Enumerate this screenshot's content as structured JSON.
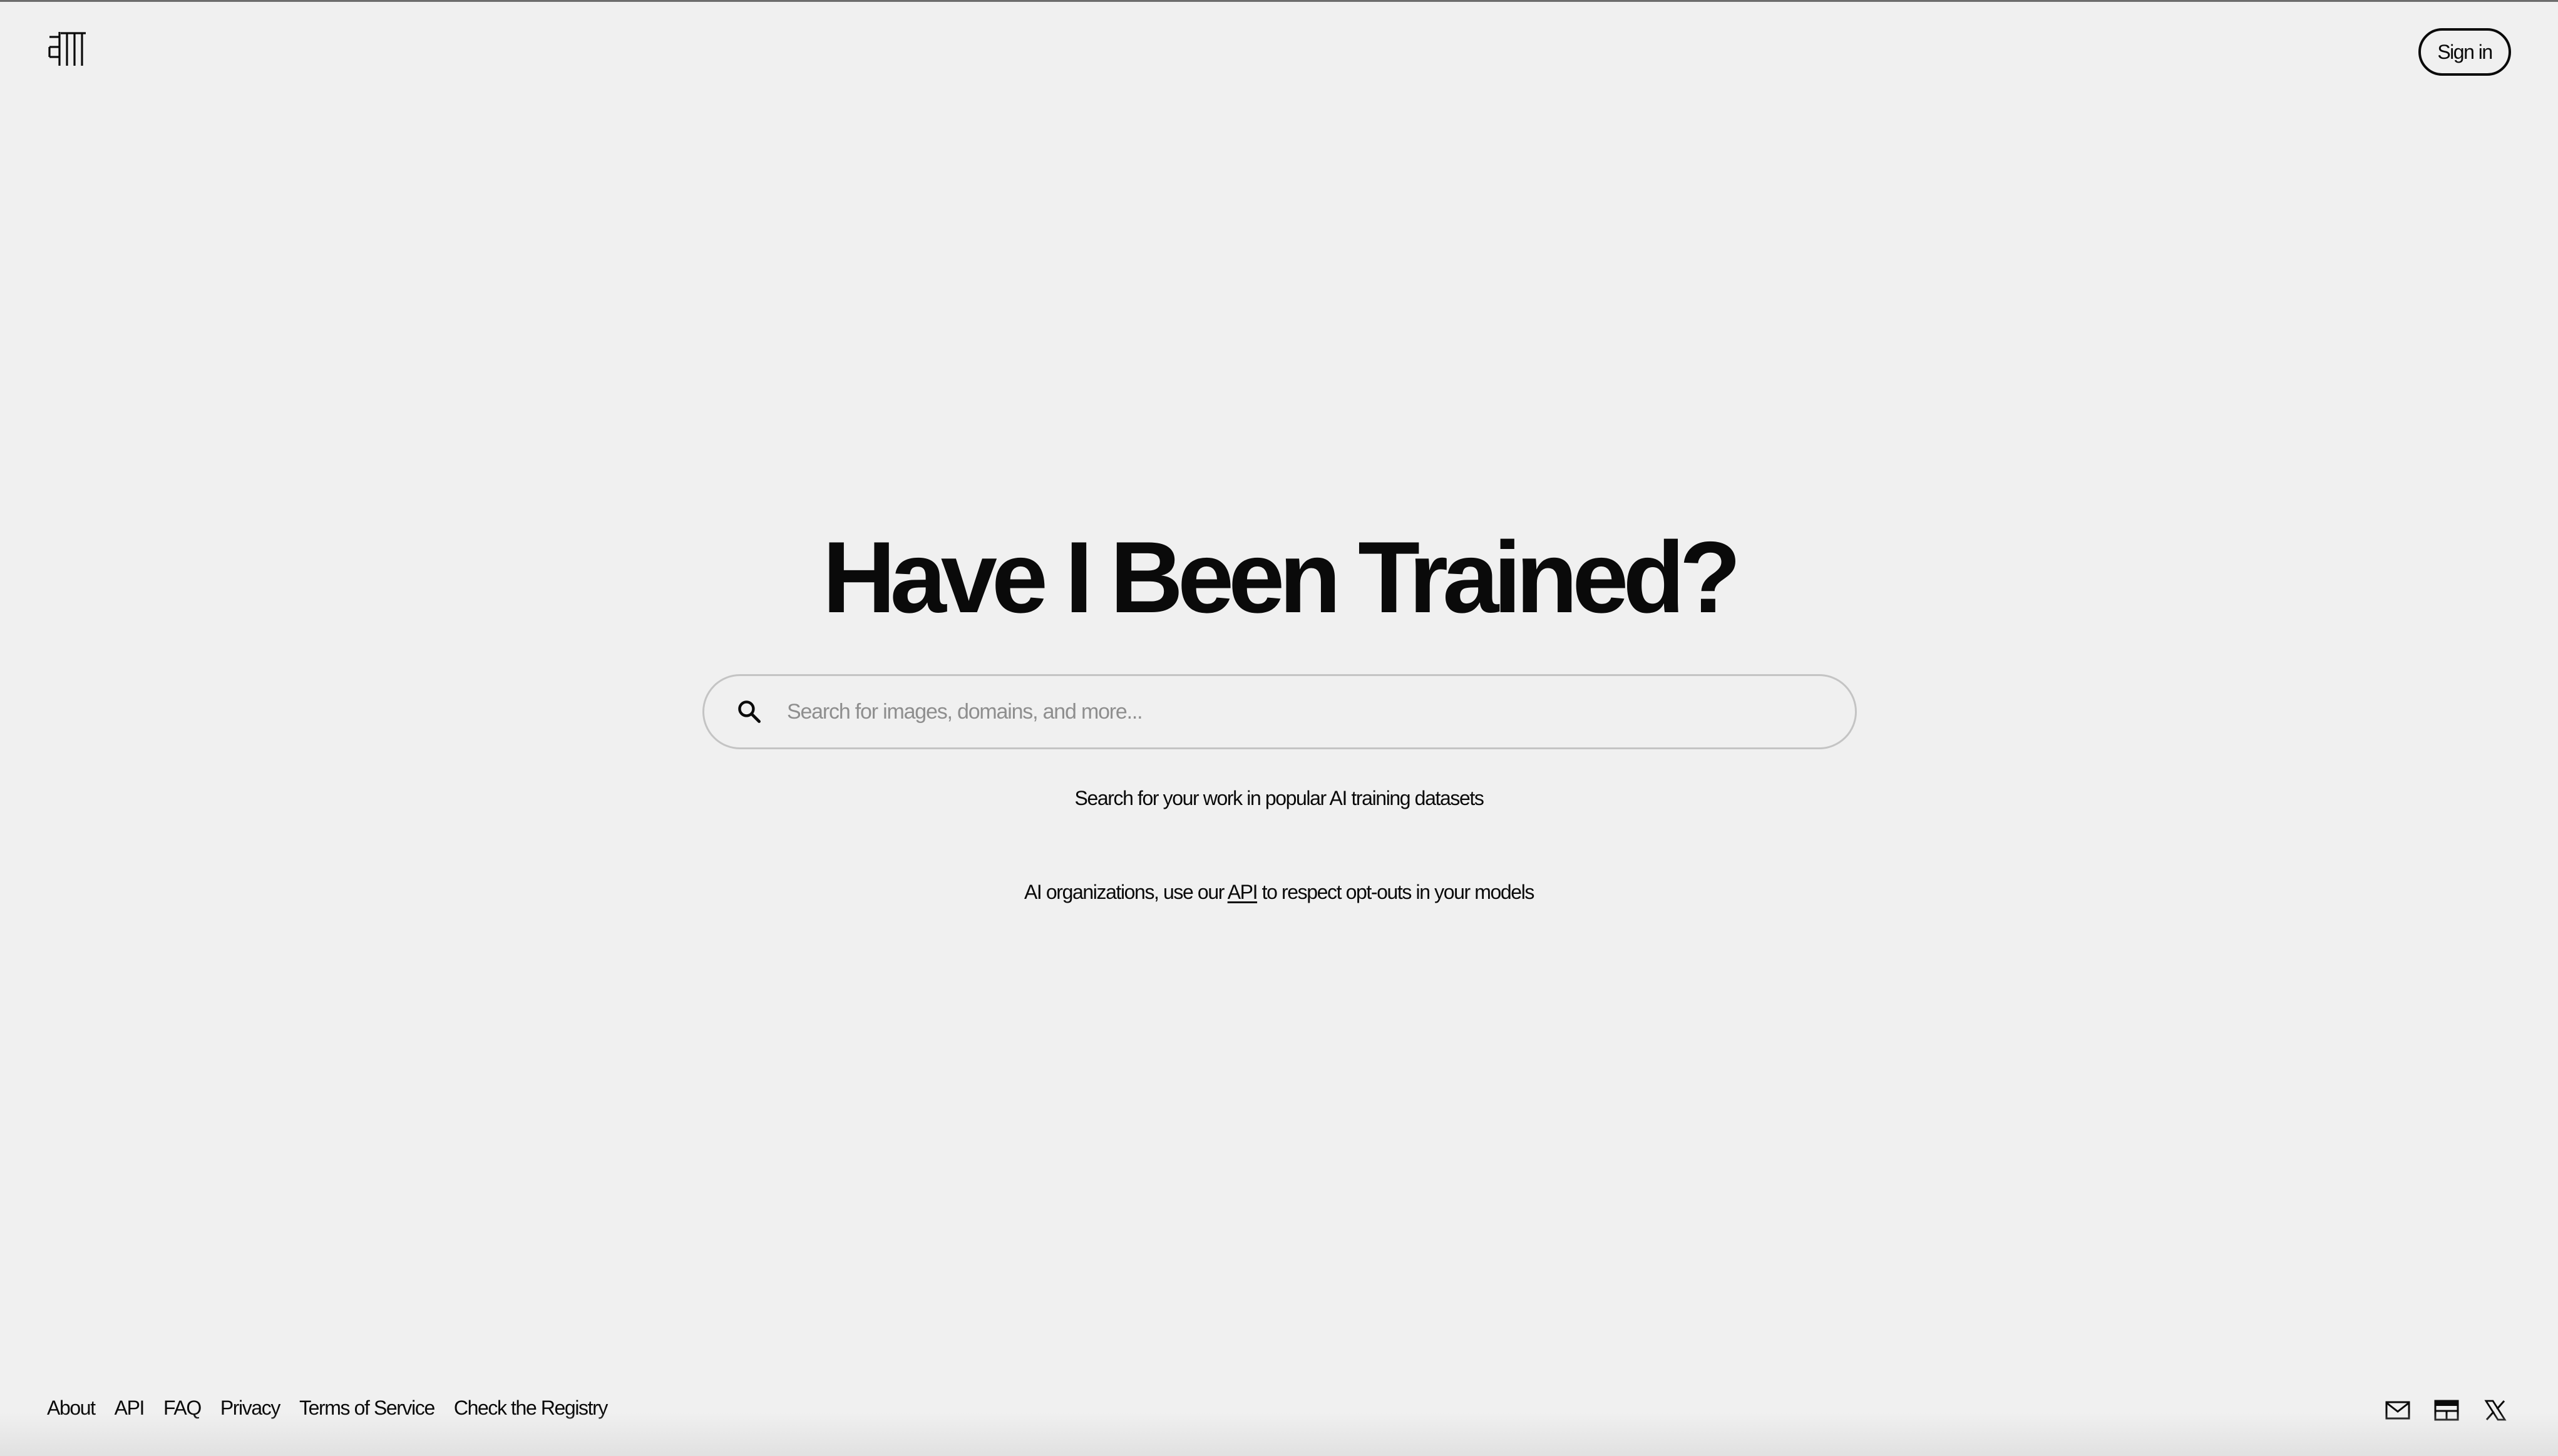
{
  "header": {
    "logo_icon": "spawning-logo-icon",
    "signin_label": "Sign in"
  },
  "hero": {
    "title": "Have I Been Trained?",
    "search": {
      "icon": "search-icon",
      "placeholder": "Search for images, domains, and more...",
      "value": ""
    },
    "tagline": "Search for your work in popular AI training datasets",
    "api_note": {
      "before": "AI organizations, use our ",
      "link": "API",
      "after": " to respect opt-outs in your models"
    }
  },
  "footer": {
    "links": [
      "About",
      "API",
      "FAQ",
      "Privacy",
      "Terms of Service",
      "Check the Registry"
    ],
    "icons": [
      "mail-icon",
      "newsletter-icon",
      "x-twitter-icon"
    ]
  },
  "colors": {
    "background": "#f0f0f0",
    "text": "#0a0a0a",
    "placeholder": "#8e8e8e",
    "search_border": "#c4c4c4"
  }
}
